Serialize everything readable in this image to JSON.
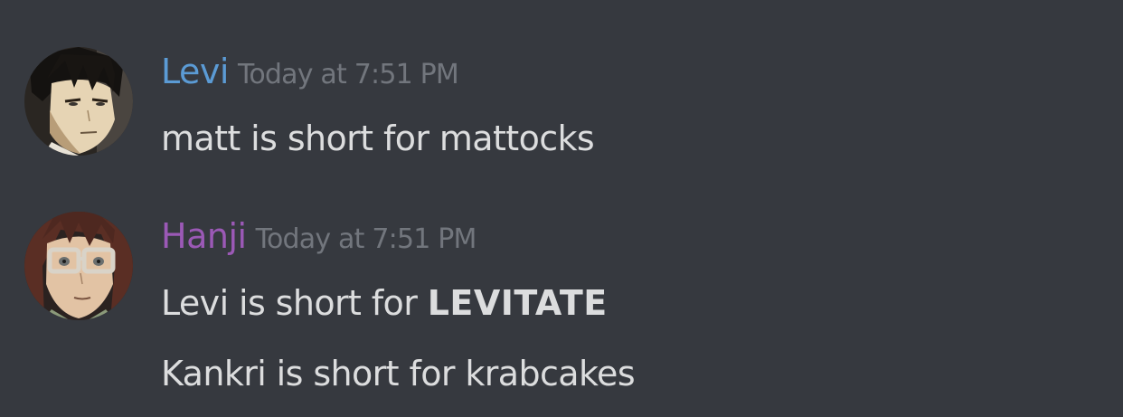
{
  "colors": {
    "background": "#36393f",
    "levi_name": "#5b9bd5",
    "hanji_name": "#9b59b6",
    "timestamp": "#72767d",
    "text": "#dcddde"
  },
  "messages": [
    {
      "author": "Levi",
      "timestamp": "Today at 7:51 PM",
      "avatar_icon": "levi-avatar",
      "lines": [
        {
          "text": "matt is short for mattocks"
        }
      ]
    },
    {
      "author": "Hanji",
      "timestamp": "Today at 7:51 PM",
      "avatar_icon": "hanji-avatar",
      "lines": [
        {
          "prefix": "Levi is short for ",
          "bold": "LEVITATE"
        },
        {
          "text": "Kankri is short for krabcakes"
        }
      ]
    }
  ]
}
